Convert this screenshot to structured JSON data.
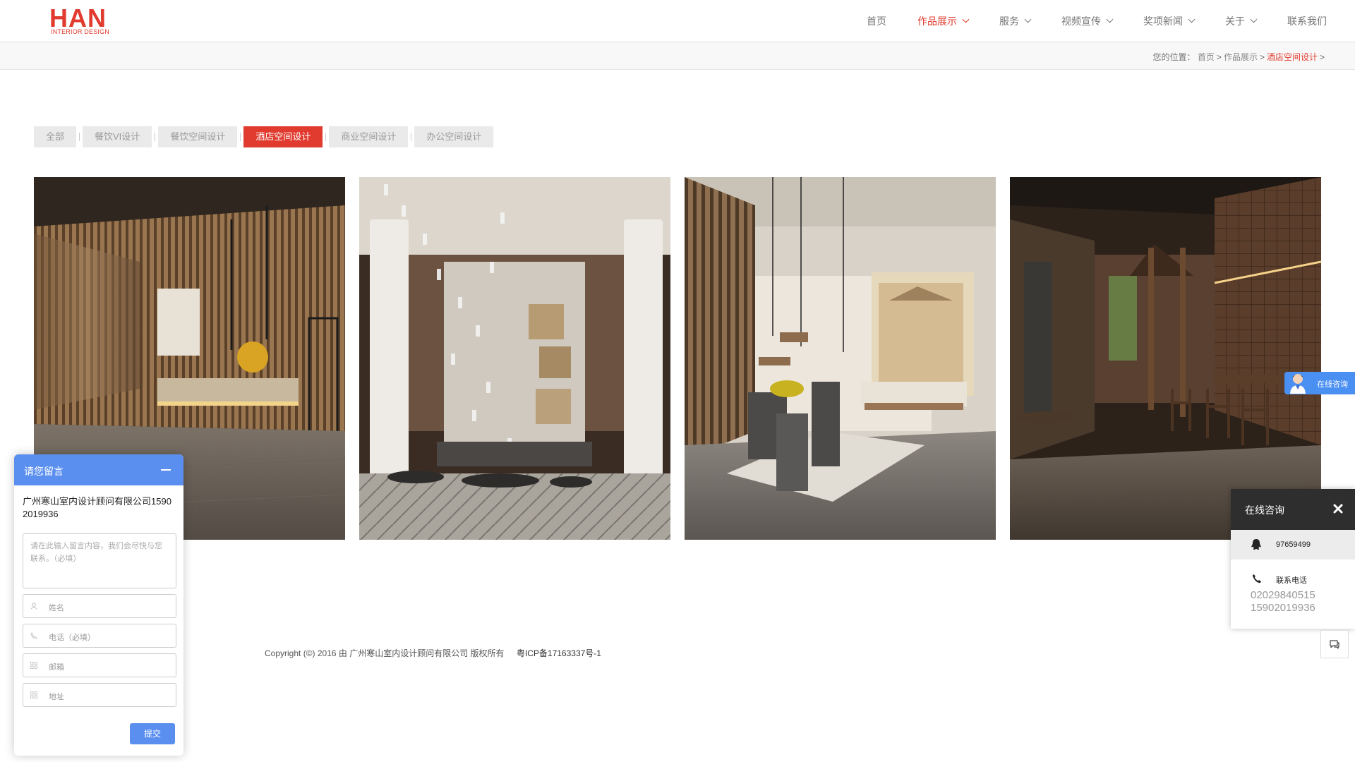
{
  "logo": {
    "main": "HAN",
    "sub": "INTERIOR DESIGN"
  },
  "nav": {
    "items": [
      {
        "label": "首页",
        "dropdown": false,
        "active": false
      },
      {
        "label": "作品展示",
        "dropdown": true,
        "active": true
      },
      {
        "label": "服务",
        "dropdown": true,
        "active": false
      },
      {
        "label": "视频宣传",
        "dropdown": true,
        "active": false
      },
      {
        "label": "奖项新闻",
        "dropdown": true,
        "active": false
      },
      {
        "label": "关于",
        "dropdown": true,
        "active": false
      },
      {
        "label": "联系我们",
        "dropdown": false,
        "active": false
      }
    ]
  },
  "breadcrumb": {
    "prefix": "您的位置：",
    "items": [
      "首页",
      "作品展示",
      "酒店空间设计"
    ],
    "separator": ">"
  },
  "filters": {
    "items": [
      "全部",
      "餐饮VI设计",
      "餐饮空间设计",
      "酒店空间设计",
      "商业空间设计",
      "办公空间设计"
    ],
    "active_index": 3
  },
  "gallery": {
    "items": [
      {
        "alt_icon": "hotel-lobby-photo-1"
      },
      {
        "alt_icon": "hotel-lobby-photo-2"
      },
      {
        "alt_icon": "hotel-lobby-photo-3"
      },
      {
        "alt_icon": "hotel-lobby-photo-4"
      }
    ]
  },
  "footer": {
    "copyright": "Copyright (©) 2016 由 广州寒山室内设计顾问有限公司 版权所有",
    "icp": "粤ICP备17163337号-1"
  },
  "message_widget": {
    "title": "请您留言",
    "company": "广州寒山室内设计顾问有限公司15902019936",
    "textarea_placeholder": "请在此输入留言内容，我们会尽快与您联系。（必填）",
    "fields": [
      "姓名",
      "电话（必填）",
      "邮箱",
      "地址"
    ],
    "submit": "提交"
  },
  "consult_tab": {
    "label": "在线咨询"
  },
  "consult_panel": {
    "title": "在线咨询",
    "qq": "97659499",
    "phone_label": "联系电话",
    "phones": [
      "02029840515",
      "15902019936"
    ]
  },
  "colors": {
    "brand": "#e13b2f",
    "widget_blue": "#5a8ff0",
    "panel_dark": "#2e2e2e"
  }
}
